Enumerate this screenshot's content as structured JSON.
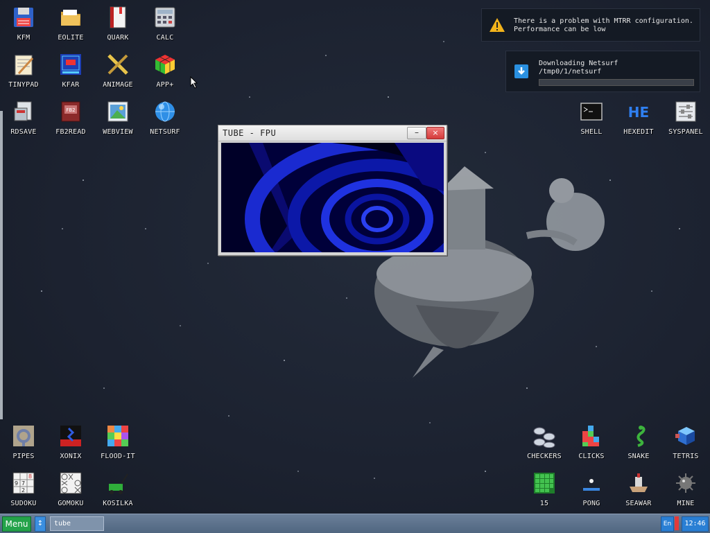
{
  "desktop": {
    "icons": [
      {
        "id": "kfm",
        "label": "KFM",
        "icon": "floppy-disk-icon"
      },
      {
        "id": "eolite",
        "label": "EOLITE",
        "icon": "folder-icon"
      },
      {
        "id": "quark",
        "label": "QUARK",
        "icon": "notebook-icon"
      },
      {
        "id": "calc",
        "label": "CALC",
        "icon": "calculator-icon"
      },
      {
        "id": "tinypad",
        "label": "TINYPAD",
        "icon": "notepad-icon"
      },
      {
        "id": "kfar",
        "label": "KFAR",
        "icon": "archive-icon"
      },
      {
        "id": "animage",
        "label": "ANIMAGE",
        "icon": "pencil-ruler-icon"
      },
      {
        "id": "appplus",
        "label": "APP+",
        "icon": "rubik-cube-icon"
      },
      {
        "id": "rdsave",
        "label": "RDSAVE",
        "icon": "ramdisk-save-icon"
      },
      {
        "id": "fb2read",
        "label": "FB2READ",
        "icon": "book-icon"
      },
      {
        "id": "webview",
        "label": "WEBVIEW",
        "icon": "webpage-icon"
      },
      {
        "id": "netsurf",
        "label": "NETSURF",
        "icon": "globe-icon"
      },
      {
        "id": "shell",
        "label": "SHELL",
        "icon": "terminal-icon"
      },
      {
        "id": "hexedit",
        "label": "HEXEDIT",
        "icon": "hex-editor-icon"
      },
      {
        "id": "syspanel",
        "label": "SYSPANEL",
        "icon": "sliders-icon"
      },
      {
        "id": "pipes",
        "label": "PIPES",
        "icon": "pipes-icon"
      },
      {
        "id": "xonix",
        "label": "XONIX",
        "icon": "xonix-icon"
      },
      {
        "id": "floodit",
        "label": "FLOOD-IT",
        "icon": "color-grid-icon"
      },
      {
        "id": "sudoku",
        "label": "SUDOKU",
        "icon": "sudoku-grid-icon"
      },
      {
        "id": "gomoku",
        "label": "GOMOKU",
        "icon": "tic-tac-toe-icon"
      },
      {
        "id": "kosilka",
        "label": "KOSILKA",
        "icon": "lawn-mower-icon"
      },
      {
        "id": "checkers",
        "label": "CHECKERS",
        "icon": "checkers-pieces-icon"
      },
      {
        "id": "clicks",
        "label": "CLICKS",
        "icon": "colored-blocks-icon"
      },
      {
        "id": "snake",
        "label": "SNAKE",
        "icon": "snake-icon"
      },
      {
        "id": "tetris",
        "label": "TETRIS",
        "icon": "tetris-block-icon"
      },
      {
        "id": "fifteen",
        "label": "15",
        "icon": "fifteen-puzzle-icon"
      },
      {
        "id": "pong",
        "label": "PONG",
        "icon": "pong-paddle-icon"
      },
      {
        "id": "seawar",
        "label": "SEAWAR",
        "icon": "battleship-icon"
      },
      {
        "id": "mine",
        "label": "MINE",
        "icon": "mine-icon"
      }
    ]
  },
  "notifications": {
    "mtrr": {
      "line1": "There is a problem with MTRR configuration.",
      "line2": "Performance can be low"
    },
    "download": {
      "title": "Downloading Netsurf",
      "path": "/tmp0/1/netsurf",
      "progress": 0.0
    }
  },
  "window": {
    "title": "TUBE - FPU",
    "minimize": "–",
    "close": "×"
  },
  "taskbar": {
    "menu_label": "Menu",
    "switch_label": "↕",
    "task_label": "tube",
    "lang": "En",
    "clock": "12:46"
  },
  "colors": {
    "accent": "#2a7fd4",
    "menu_green": "#24a34a",
    "close_red": "#d43b3b",
    "desktop_bg": "#1c2230"
  }
}
